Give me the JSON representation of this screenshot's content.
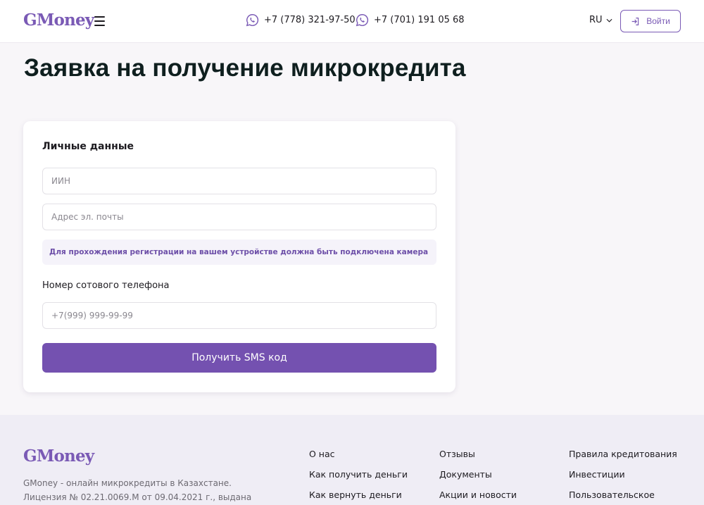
{
  "header": {
    "logo": "GMoney",
    "phones": [
      "+7 (778) 321-97-50",
      "+7 (701) 191 05 68"
    ],
    "language": "RU",
    "login_label": "Войти"
  },
  "main": {
    "title": "Заявка на получение микрокредита",
    "form": {
      "section_title": "Личные данные",
      "iin_placeholder": "ИИН",
      "email_placeholder": "Адрес эл. почты",
      "notice": "Для прохождения регистрации на вашем устройстве должна быть подключена камера",
      "phone_label": "Номер сотового телефона",
      "phone_placeholder": "+7(999) 999-99-99",
      "submit_label": "Получить SMS код"
    }
  },
  "footer": {
    "logo": "GMoney",
    "description": "GMoney - онлайн микрокредиты в Казахстане. Лицензия № 02.21.0069.М от 09.04.2021 г., выдана Управлением",
    "links": [
      [
        "О нас",
        "Как получить деньги",
        "Как вернуть деньги"
      ],
      [
        "Отзывы",
        "Документы",
        "Акции и новости"
      ],
      [
        "Правила кредитования",
        "Инвестиции",
        "Пользовательское"
      ]
    ]
  },
  "colors": {
    "brand": "#7a5ab5",
    "button": "#7451b0",
    "background": "#f8f6f9",
    "footer": "#efedf5"
  }
}
